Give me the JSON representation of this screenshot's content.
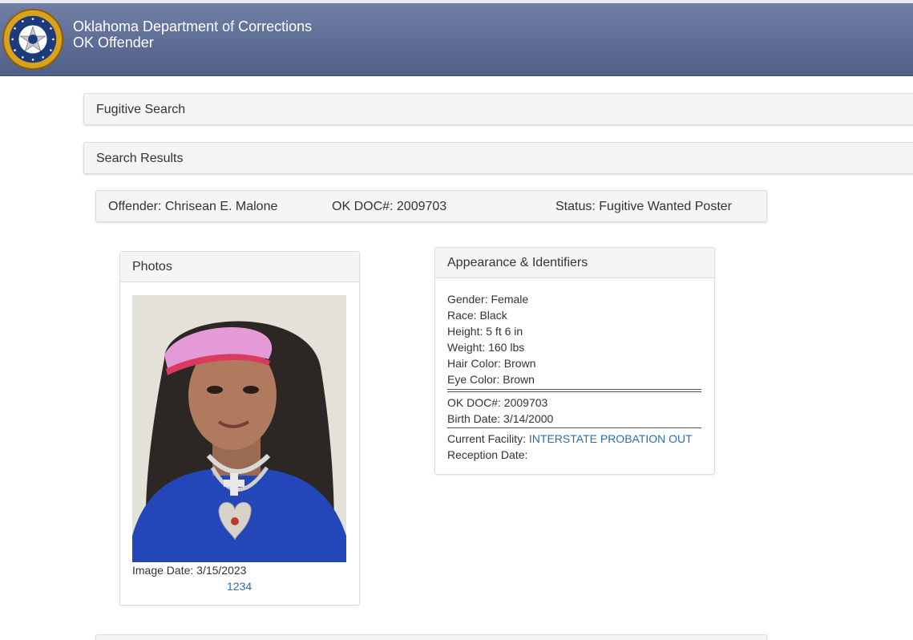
{
  "header": {
    "agency": "Oklahoma Department of Corrections",
    "app": "OK Offender"
  },
  "sections": {
    "fugitive_search": "Fugitive Search",
    "search_results": "Search Results"
  },
  "offender_bar": {
    "offender": "Offender: Chrisean E. Malone",
    "doc": "OK DOC#: 2009703",
    "status_label": "Status:",
    "status_value": "Fugitive",
    "wanted_poster": "Wanted Poster"
  },
  "photos": {
    "title": "Photos",
    "image_date": "Image Date: 3/15/2023",
    "pages": [
      "1",
      "2",
      "3",
      "4"
    ]
  },
  "appearance": {
    "title": "Appearance & Identifiers",
    "gender": "Gender: Female",
    "race": "Race: Black",
    "height": "Height: 5 ft 6 in",
    "weight": "Weight: 160 lbs",
    "hair": "Hair Color: Brown",
    "eye": "Eye Color: Brown",
    "doc": "OK DOC#: 2009703",
    "birth": "Birth Date: 3/14/2000",
    "facility_label": "Current Facility:",
    "facility_value": "INTERSTATE PROBATION OUT",
    "reception": "Reception Date:"
  },
  "colors": {
    "header": "#5d6d94",
    "link": "#2a6cb0",
    "fugitive": "#e00000"
  }
}
